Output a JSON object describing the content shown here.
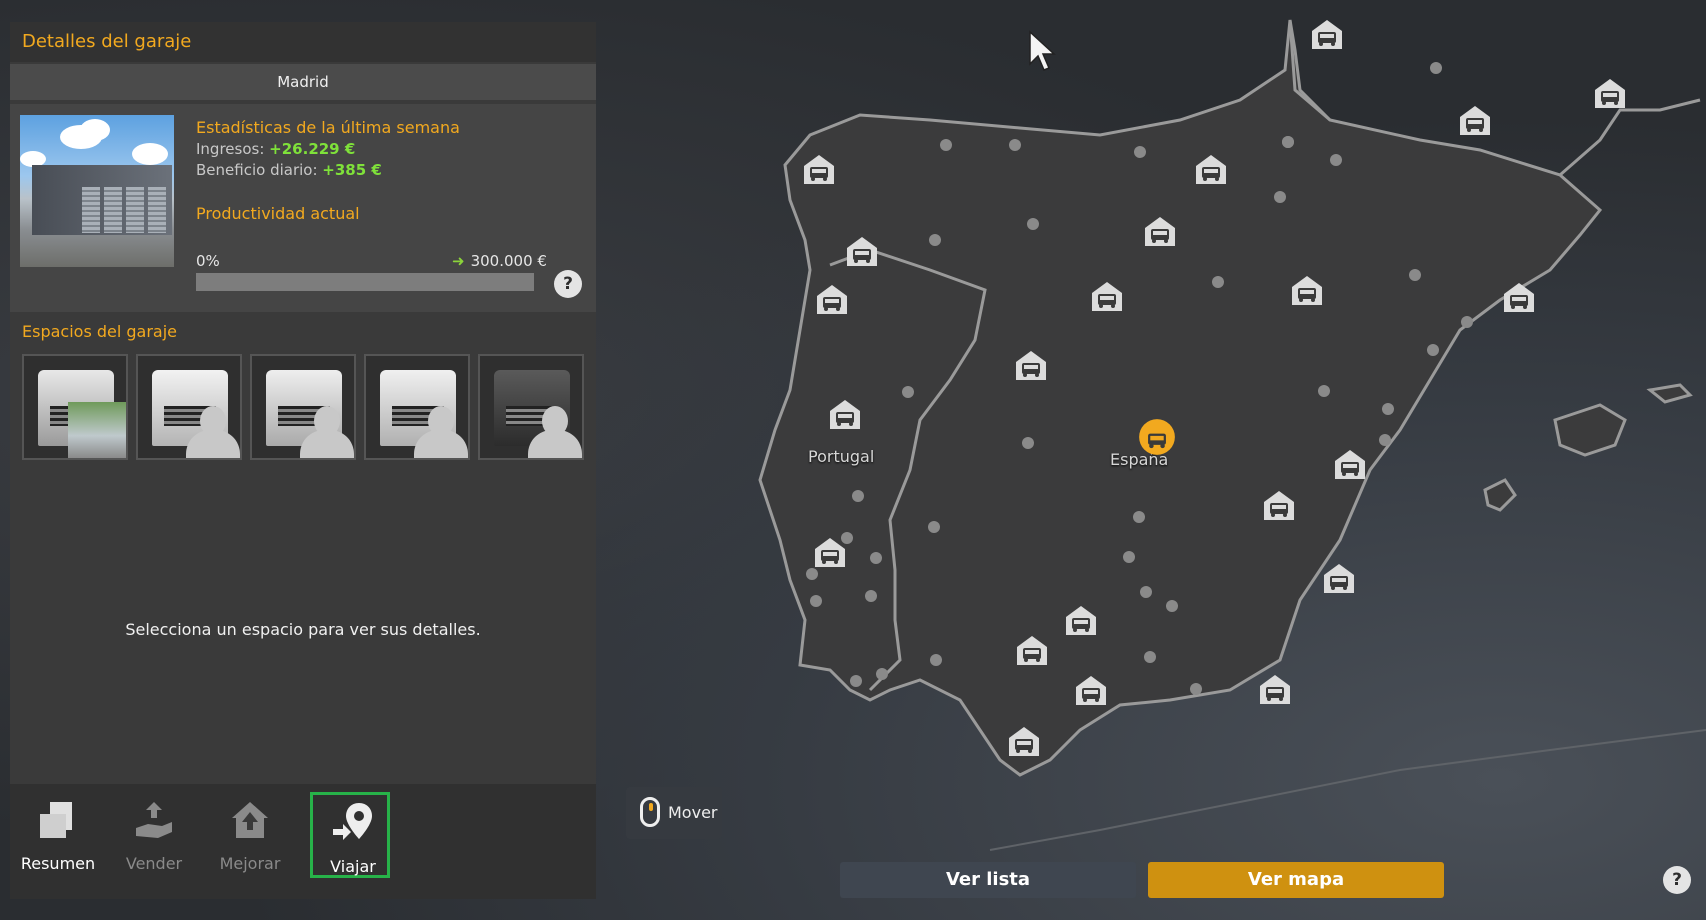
{
  "panel": {
    "title": "Detalles del garaje",
    "city": "Madrid",
    "stats": {
      "heading": "Estadísticas de la última semana",
      "income_label": "Ingresos:",
      "income_value": "+26.229 €",
      "profit_label": "Beneficio diario:",
      "profit_value": "+385 €"
    },
    "productivity": {
      "heading": "Productividad actual",
      "min_label": "0%",
      "max_label": "300.000 €",
      "fill_fraction": 0
    },
    "help_label": "?",
    "slots_heading": "Espacios del garaje",
    "slot_hint": "Selecciona un espacio para ver sus detalles.",
    "actions": [
      {
        "label": "Resumen",
        "enabled": true
      },
      {
        "label": "Vender",
        "enabled": false
      },
      {
        "label": "Mejorar",
        "enabled": false
      },
      {
        "label": "Viajar",
        "enabled": true,
        "selected": true
      }
    ]
  },
  "map": {
    "country_labels": [
      "Portugal",
      "España"
    ],
    "mover_label": "Mover",
    "help_label": "?",
    "buttons": {
      "list": "Ver lista",
      "map": "Ver mapa"
    },
    "colors": {
      "land": "#3f3f3f",
      "border": "#9a9a9a",
      "garage_pin": "#dcdcdc",
      "home_garage": "#f2a91f"
    }
  }
}
